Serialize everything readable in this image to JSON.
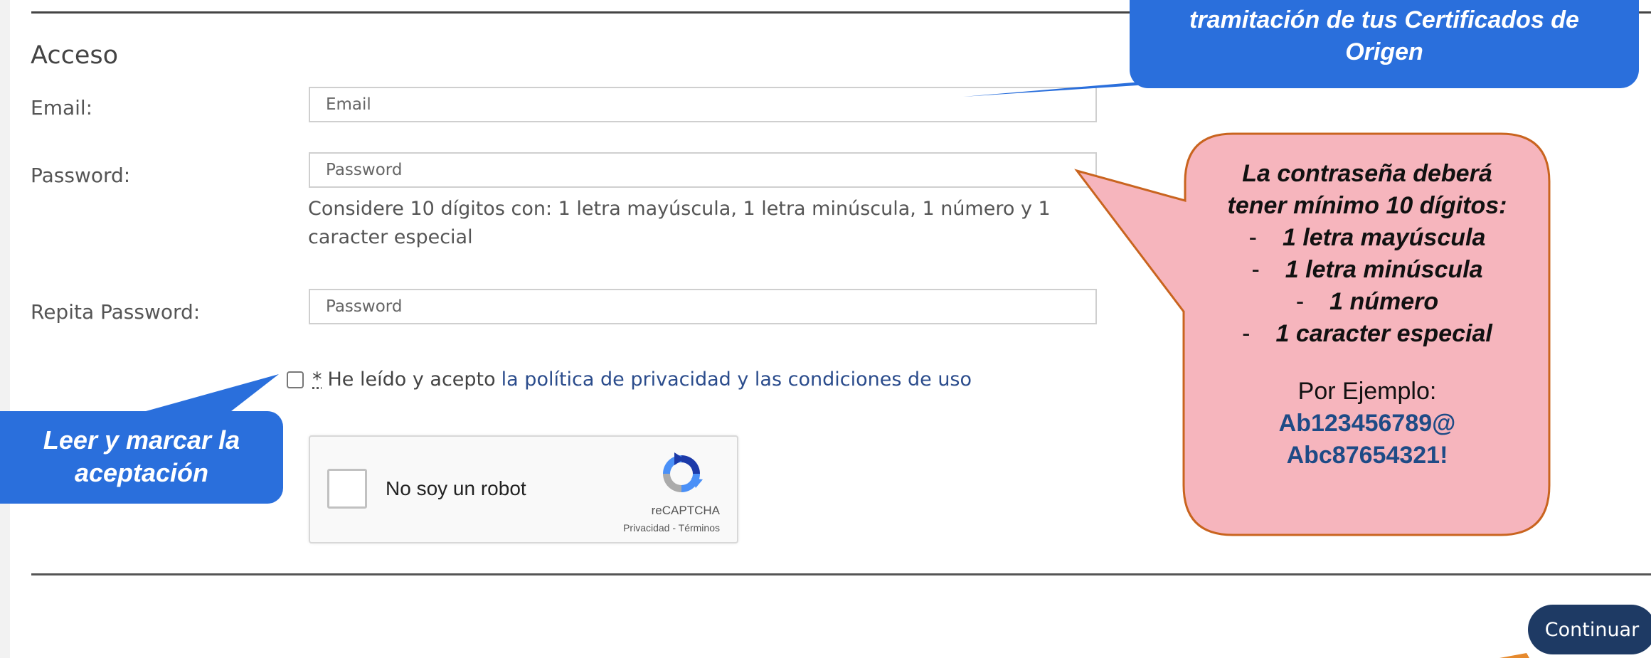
{
  "form": {
    "section_title": "Acceso",
    "email_label": "Email:",
    "email_placeholder": "Email",
    "password_label": "Password:",
    "password_placeholder": "Password",
    "password_hint": "Considere 10 dígitos con: 1 letra mayúscula, 1 letra minúscula, 1 número y 1 caracter especial",
    "repeat_label": "Repita Password:",
    "repeat_placeholder": "Password",
    "consent_required_mark": "*",
    "consent_text": "He leído y acepto",
    "consent_link": "la política de privacidad y las condiciones de uso"
  },
  "captcha": {
    "label": "No soy un robot",
    "brand": "reCAPTCHA",
    "terms": "Privacidad - Términos"
  },
  "actions": {
    "continue_label": "Continuar"
  },
  "callouts": {
    "top_line1": "tramitación de tus Certificados de",
    "top_line2": "Origen",
    "left_line1": "Leer y marcar la",
    "left_line2": "aceptación",
    "pink_line1": "La contraseña deberá",
    "pink_line2": "tener mínimo 10 dígitos:",
    "pink_items": [
      "1 letra mayúscula",
      "1 letra minúscula",
      "1 número",
      "1 caracter especial"
    ],
    "pink_example": "Por Ejemplo:",
    "pink_code1": "Ab123456789@",
    "pink_code2": "Abc87654321!"
  },
  "colors": {
    "callout_blue": "#2a6fdc",
    "callout_pink": "#f6b5bd",
    "callout_pink_border": "#c9641f",
    "button_navy": "#1e3a64",
    "link_blue": "#2b4c8c"
  }
}
